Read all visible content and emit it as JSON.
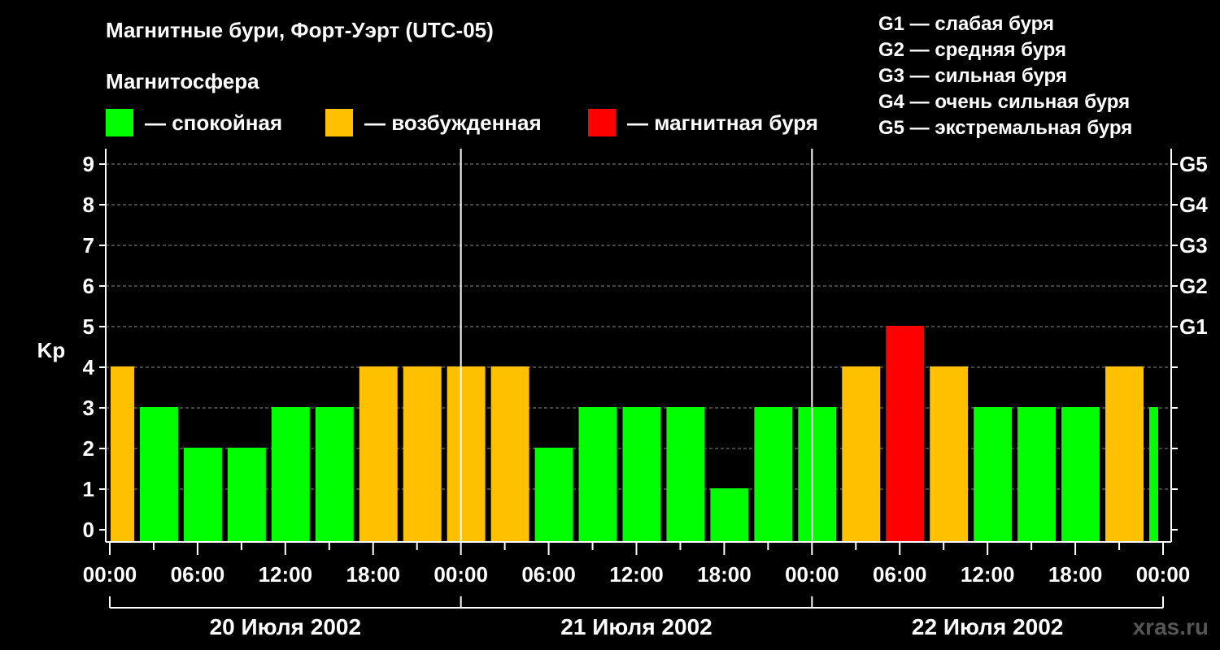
{
  "title": "Магнитные бури, Форт-Уэрт (UTC-05)",
  "legend": {
    "heading": "Магнитосфера",
    "items": [
      {
        "label": "— спокойная",
        "color": "#00ff00"
      },
      {
        "label": "— возбужденная",
        "color": "#ffc000"
      },
      {
        "label": "— магнитная буря",
        "color": "#ff0000"
      }
    ]
  },
  "storm_scale": [
    "G1 — слабая буря",
    "G2 — средняя буря",
    "G3 — сильная буря",
    "G4 — очень сильная буря",
    "G5 — экстремальная буря"
  ],
  "watermark": "xras.ru",
  "chart_data": {
    "type": "bar",
    "ylabel": "Kp",
    "ylim": [
      0,
      9
    ],
    "yticks": [
      0,
      1,
      2,
      3,
      4,
      5,
      6,
      7,
      8,
      9
    ],
    "right_axis_labels": [
      {
        "value": 5,
        "label": "G1"
      },
      {
        "value": 6,
        "label": "G2"
      },
      {
        "value": 7,
        "label": "G3"
      },
      {
        "value": 8,
        "label": "G4"
      },
      {
        "value": 9,
        "label": "G5"
      }
    ],
    "x_tick_labels": [
      "00:00",
      "06:00",
      "12:00",
      "18:00",
      "00:00",
      "06:00",
      "12:00",
      "18:00",
      "00:00",
      "06:00",
      "12:00",
      "18:00",
      "00:00"
    ],
    "days": [
      "20 Июля 2002",
      "21 Июля 2002",
      "22 Июля 2002"
    ],
    "bar_interval_hours": 3,
    "x_hours_start": -1,
    "values": [
      4,
      3,
      2,
      2,
      3,
      3,
      4,
      4,
      4,
      4,
      2,
      3,
      3,
      3,
      1,
      3,
      3,
      4,
      5,
      4,
      3,
      3,
      3,
      4,
      3
    ],
    "colors": {
      "quiet": "#00ff00",
      "active": "#ffc000",
      "storm": "#ff0000"
    },
    "grid": true
  }
}
